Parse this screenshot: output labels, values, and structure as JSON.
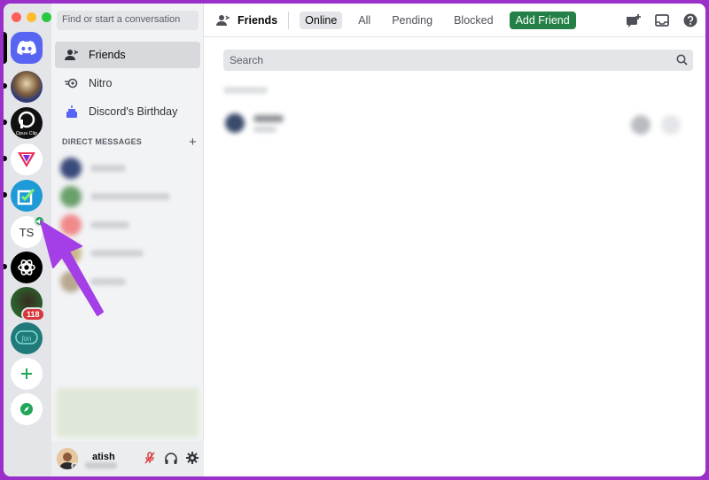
{
  "servers": {
    "ts_label": "TS",
    "badge_count": "118"
  },
  "sidebar": {
    "find_placeholder": "Find or start a conversation",
    "nav": [
      {
        "label": "Friends"
      },
      {
        "label": "Nitro"
      },
      {
        "label": "Discord's Birthday"
      }
    ],
    "dm_header": "DIRECT MESSAGES",
    "dm_add": "+"
  },
  "user": {
    "name": "atish"
  },
  "topbar": {
    "title": "Friends",
    "tabs": [
      "Online",
      "All",
      "Pending",
      "Blocked"
    ],
    "add_friend": "Add Friend"
  },
  "main": {
    "search_placeholder": "Search"
  },
  "colors": {
    "background": "#9b2fc9",
    "discord_blurple": "#5865f2",
    "add_friend_green": "#248046",
    "arrow": "#a43ee6",
    "badge_red": "#da373c"
  },
  "icons": [
    "discord-logo",
    "friends-icon",
    "nitro-icon",
    "birthday-cake-icon",
    "mute-mic-icon",
    "headphones-icon",
    "settings-gear-icon",
    "new-group-dm-icon",
    "inbox-icon",
    "help-icon",
    "search-icon",
    "add-server-icon",
    "explore-compass-icon"
  ]
}
